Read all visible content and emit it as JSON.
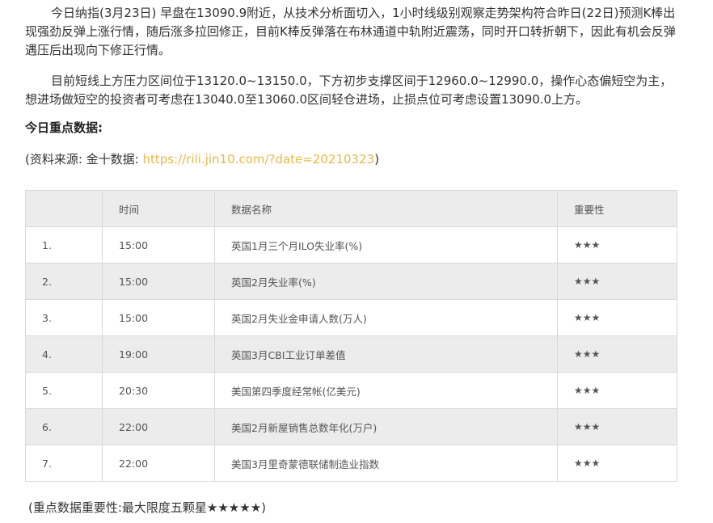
{
  "article": {
    "paragraph1": "今日纳指(3月23日) 早盘在13090.9附近，从技术分析面切入，1小时线级别观察走势架构符合昨日(22日)预测K棒出现强劲反弹上涨行情，随后涨多拉回修正，目前K棒反弹落在布林通道中轨附近震荡，同时开口转折朝下，因此有机会反弹遇压后出现向下修正行情。",
    "paragraph2": "目前短线上方压力区间位于13120.0~13150.0，下方初步支撑区间于12960.0~12990.0，操作心态偏短空为主，想进场做短空的投资者可考虑在13040.0至13060.0区间轻仓进场，止损点位可考虑设置13090.0上方。",
    "section_title": "今日重点数据:",
    "source_prefix": "(资料来源: 金十数据: ",
    "source_link": "https://rili.jin10.com/?date=20210323",
    "source_suffix": ")"
  },
  "table": {
    "headers": [
      "",
      "时间",
      "数据名称",
      "重要性"
    ],
    "rows": [
      {
        "index": "1.",
        "time": "15:00",
        "name": "英国1月三个月ILO失业率(%)",
        "importance": "★★★"
      },
      {
        "index": "2.",
        "time": "15:00",
        "name": "英国2月失业率(%)",
        "importance": "★★★"
      },
      {
        "index": "3.",
        "time": "15:00",
        "name": "英国2月失业金申请人数(万人)",
        "importance": "★★★"
      },
      {
        "index": "4.",
        "time": "19:00",
        "name": "英国3月CBI工业订单差值",
        "importance": "★★★"
      },
      {
        "index": "5.",
        "time": "20:30",
        "name": "美国第四季度经常帐(亿美元)",
        "importance": "★★★"
      },
      {
        "index": "6.",
        "time": "22:00",
        "name": "美国2月新屋销售总数年化(万户)",
        "importance": "★★★"
      },
      {
        "index": "7.",
        "time": "22:00",
        "name": "美国3月里奇蒙德联储制造业指数",
        "importance": "★★★"
      }
    ]
  },
  "footnote": "(重点数据重要性:最大限度五颗星★★★★★)",
  "colors": {
    "link": "#e8b84a",
    "text": "#333333",
    "row_alt": "#ececec",
    "border": "#d9d9d9"
  }
}
